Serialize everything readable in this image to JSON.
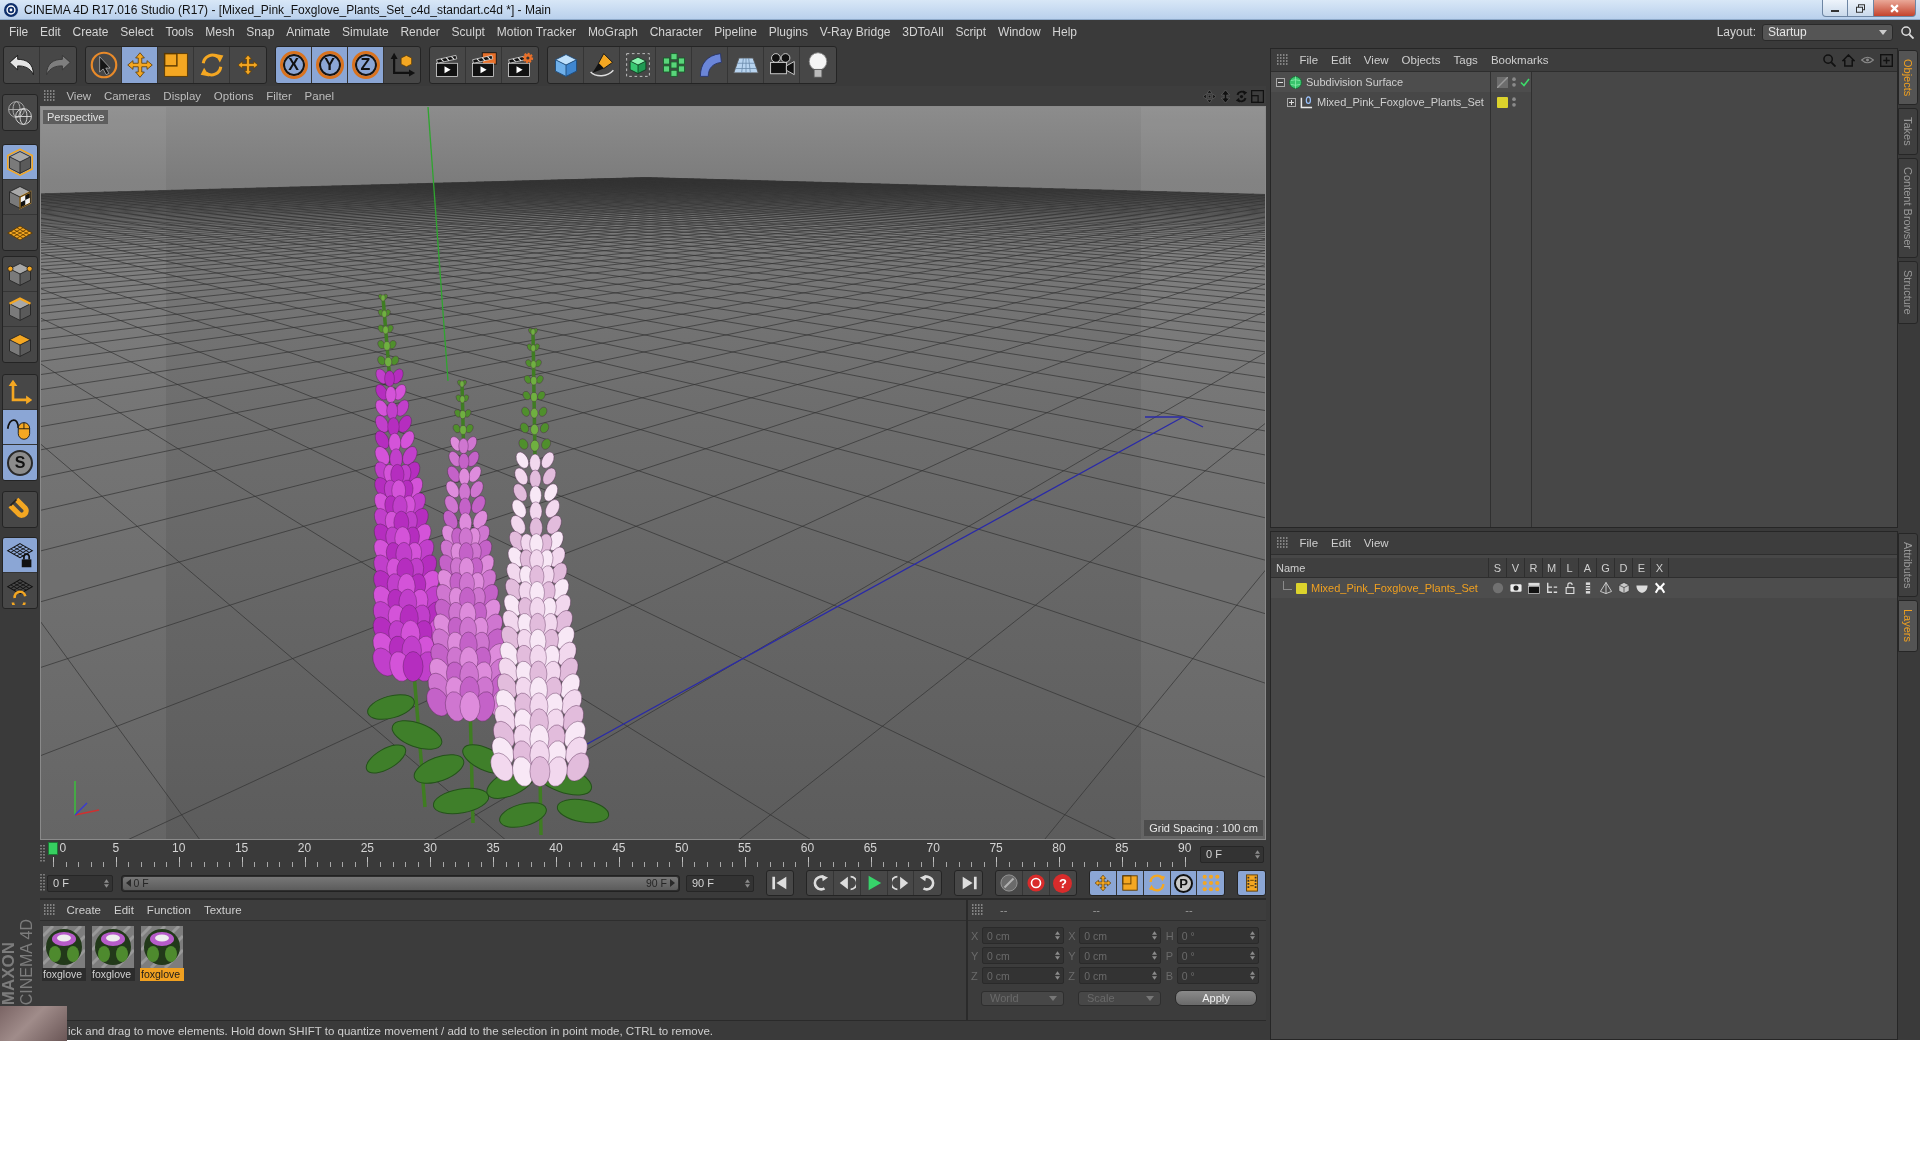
{
  "window": {
    "title": "CINEMA 4D R17.016 Studio (R17) - [Mixed_Pink_Foxglove_Plants_Set_c4d_standart.c4d *] - Main"
  },
  "menu_bar": {
    "items": [
      "File",
      "Edit",
      "Create",
      "Select",
      "Tools",
      "Mesh",
      "Snap",
      "Animate",
      "Simulate",
      "Render",
      "Sculpt",
      "Motion Tracker",
      "MoGraph",
      "Character",
      "Pipeline",
      "Plugins",
      "V-Ray Bridge",
      "3DToAll",
      "Script",
      "Window",
      "Help"
    ],
    "layout_label": "Layout:",
    "layout_value": "Startup"
  },
  "toolbar": {
    "groups": [
      [
        {
          "kind": "undo",
          "selected": false,
          "disabled": false
        },
        {
          "kind": "redo",
          "selected": false,
          "disabled": true
        }
      ],
      [
        {
          "kind": "select",
          "selected": false,
          "disabled": false
        },
        {
          "kind": "move",
          "selected": true,
          "disabled": false
        },
        {
          "kind": "scale",
          "selected": false,
          "disabled": false
        },
        {
          "kind": "rotate",
          "selected": false,
          "disabled": false
        },
        {
          "kind": "transform",
          "selected": false,
          "disabled": false
        }
      ],
      [
        {
          "kind": "x-axis",
          "label": "X",
          "selected": true,
          "disabled": false
        },
        {
          "kind": "y-axis",
          "label": "Y",
          "selected": true,
          "disabled": false
        },
        {
          "kind": "z-axis",
          "label": "Z",
          "selected": true,
          "disabled": false
        },
        {
          "kind": "coordinates",
          "selected": false,
          "disabled": false
        }
      ],
      [
        {
          "kind": "render-view",
          "selected": false,
          "disabled": false
        },
        {
          "kind": "render-picture",
          "selected": false,
          "disabled": false
        },
        {
          "kind": "render-settings",
          "selected": false,
          "disabled": false
        }
      ],
      [
        {
          "kind": "cube",
          "selected": false,
          "disabled": false
        },
        {
          "kind": "pen",
          "selected": false,
          "disabled": false
        },
        {
          "kind": "subdivision",
          "selected": false,
          "disabled": false
        },
        {
          "kind": "cloner",
          "selected": false,
          "disabled": false
        },
        {
          "kind": "bend",
          "selected": false,
          "disabled": false
        },
        {
          "kind": "floor",
          "selected": false,
          "disabled": false
        },
        {
          "kind": "camera",
          "selected": false,
          "disabled": false
        },
        {
          "kind": "light",
          "selected": false,
          "disabled": false
        }
      ]
    ]
  },
  "left_toolbar": {
    "groups": [
      [
        {
          "kind": "editable",
          "selected": false
        }
      ],
      [
        {
          "kind": "model",
          "selected": true
        },
        {
          "kind": "texture",
          "selected": false
        },
        {
          "kind": "workplane",
          "selected": false
        }
      ],
      [
        {
          "kind": "points",
          "selected": false
        },
        {
          "kind": "edges",
          "selected": false
        },
        {
          "kind": "polygons",
          "selected": false
        }
      ],
      [
        {
          "kind": "axis",
          "selected": false
        },
        {
          "kind": "tweak",
          "selected": true
        },
        {
          "kind": "snap",
          "label": "S",
          "selected": true
        }
      ],
      [
        {
          "kind": "magnet",
          "selected": false
        }
      ],
      [
        {
          "kind": "lock-workplane",
          "selected": true
        },
        {
          "kind": "align-workplane",
          "selected": false
        }
      ]
    ]
  },
  "viewport": {
    "menu": [
      "View",
      "Cameras",
      "Display",
      "Options",
      "Filter",
      "Panel"
    ],
    "camera": "Perspective",
    "grid_spacing": "Grid Spacing : 100 cm"
  },
  "timeline": {
    "ticks": [
      "0",
      "5",
      "10",
      "15",
      "20",
      "25",
      "30",
      "35",
      "40",
      "45",
      "50",
      "55",
      "60",
      "65",
      "70",
      "75",
      "80",
      "85",
      "90"
    ],
    "playhead": {
      "level": 0
    },
    "current_frame": "0 F"
  },
  "playback": {
    "start_frame": "0 F",
    "range": {
      "start": "0 F",
      "end": "90 F",
      "level": 1
    },
    "end_frame": "90 F",
    "groups": [
      [
        {
          "kind": "first",
          "selected": false
        }
      ],
      [
        {
          "kind": "prev-key",
          "selected": false
        },
        {
          "kind": "prev-frame",
          "selected": false
        },
        {
          "kind": "play",
          "selected": false
        },
        {
          "kind": "next-frame",
          "selected": false
        },
        {
          "kind": "next-key",
          "selected": false
        }
      ],
      [
        {
          "kind": "last",
          "selected": false
        }
      ],
      [
        {
          "kind": "autokey",
          "selected": false
        },
        {
          "kind": "record",
          "selected": false
        },
        {
          "kind": "key-selection",
          "label": "?",
          "selected": false
        }
      ],
      [
        {
          "kind": "position-key",
          "selected": true
        },
        {
          "kind": "scale-key",
          "selected": true
        },
        {
          "kind": "rotation-key",
          "selected": true
        },
        {
          "kind": "parameter-key",
          "label": "P",
          "selected": true
        },
        {
          "kind": "point-key",
          "selected": true
        }
      ],
      [
        {
          "kind": "timeline",
          "selected": true
        }
      ]
    ]
  },
  "materials": {
    "menu": [
      "Create",
      "Edit",
      "Function",
      "Texture"
    ],
    "items": [
      {
        "name": "foxglove",
        "selected": false
      },
      {
        "name": "foxglove",
        "selected": false
      },
      {
        "name": "foxglove",
        "selected": true
      }
    ]
  },
  "coordinates": {
    "disabled": true,
    "columns": [
      {
        "header": "--",
        "fields": [
          {
            "label": "X",
            "value": "0 cm"
          },
          {
            "label": "Y",
            "value": "0 cm"
          },
          {
            "label": "Z",
            "value": "0 cm"
          }
        ]
      },
      {
        "header": "--",
        "fields": [
          {
            "label": "X",
            "value": "0 cm"
          },
          {
            "label": "Y",
            "value": "0 cm"
          },
          {
            "label": "Z",
            "value": "0 cm"
          }
        ]
      },
      {
        "header": "--",
        "fields": [
          {
            "label": "H",
            "value": "0 °"
          },
          {
            "label": "P",
            "value": "0 °"
          },
          {
            "label": "B",
            "value": "0 °"
          }
        ]
      }
    ],
    "mode": "World",
    "size_mode": "Scale",
    "apply": "Apply"
  },
  "status_bar": {
    "text": "ick and drag to move elements. Hold down SHIFT to quantize movement / add to the selection in point mode, CTRL to remove."
  },
  "branding": {
    "company": "MAXON",
    "product": "CINEMA 4D"
  },
  "object_manager": {
    "menu": [
      "File",
      "Edit",
      "View",
      "Objects",
      "Tags",
      "Bookmarks"
    ],
    "objects": [
      {
        "kind": "subdivision",
        "name": "Subdivision Surface",
        "expanded": true,
        "enabled": true,
        "children": [
          {
            "kind": "null",
            "name": "Mixed_Pink_Foxglove_Plants_Set",
            "expanded": false,
            "color": "#dcd32c"
          }
        ]
      }
    ]
  },
  "layer_manager": {
    "menu": [
      "File",
      "Edit",
      "View"
    ],
    "columns": [
      "Name",
      "S",
      "V",
      "R",
      "M",
      "L",
      "A",
      "G",
      "D",
      "E",
      "X"
    ],
    "layers": [
      {
        "name": "Mixed_Pink_Foxglove_Plants_Set",
        "color": "#dcd32c",
        "selected": true,
        "toggles": [
          {
            "on": false
          },
          {
            "on": true
          },
          {
            "on": true
          },
          {
            "on": true
          },
          {
            "on": true
          },
          {
            "on": true
          },
          {
            "on": true
          },
          {
            "on": true
          },
          {
            "on": true
          },
          {
            "on": true
          }
        ]
      }
    ]
  },
  "side_tabs": {
    "upper": [
      {
        "label": "Objects",
        "selected": true
      },
      {
        "label": "Takes",
        "selected": false
      },
      {
        "label": "Content Browser",
        "selected": false
      },
      {
        "label": "Structure",
        "selected": false
      }
    ],
    "lower": [
      {
        "label": "Attributes",
        "selected": false
      },
      {
        "label": "Layers",
        "selected": true
      }
    ]
  }
}
